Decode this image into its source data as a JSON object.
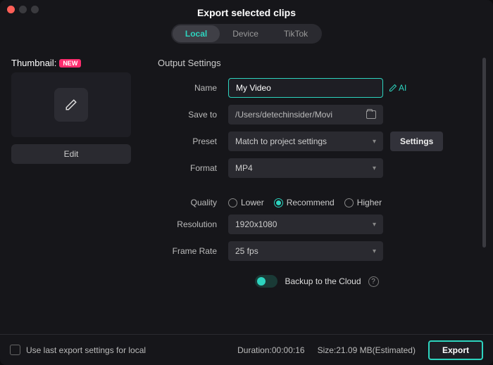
{
  "title": "Export selected clips",
  "tabs": {
    "local": "Local",
    "device": "Device",
    "tiktok": "TikTok"
  },
  "thumbnail": {
    "label": "Thumbnail:",
    "badge": "NEW",
    "edit": "Edit"
  },
  "settings": {
    "section": "Output Settings",
    "name_label": "Name",
    "name_value": "My Video",
    "saveto_label": "Save to",
    "saveto_value": "/Users/detechinsider/Movi",
    "preset_label": "Preset",
    "preset_value": "Match to project settings",
    "settings_btn": "Settings",
    "format_label": "Format",
    "format_value": "MP4",
    "quality_label": "Quality",
    "quality_lower": "Lower",
    "quality_recommend": "Recommend",
    "quality_higher": "Higher",
    "resolution_label": "Resolution",
    "resolution_value": "1920x1080",
    "framerate_label": "Frame Rate",
    "framerate_value": "25 fps",
    "backup_label": "Backup to the Cloud",
    "ai_label": "AI"
  },
  "footer": {
    "use_last": "Use last export settings for local",
    "duration_label": "Duration:",
    "duration_value": "00:00:16",
    "size_label": "Size:",
    "size_value": "21.09 MB",
    "size_suffix": "(Estimated)",
    "export": "Export"
  }
}
